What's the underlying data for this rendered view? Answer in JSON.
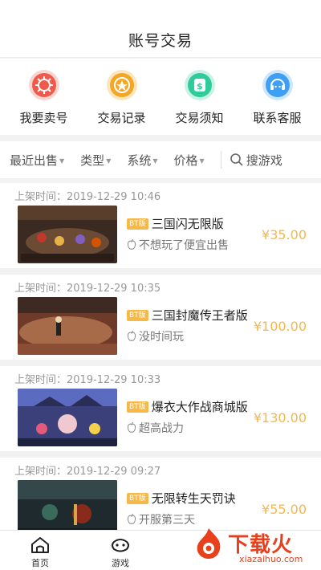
{
  "header": {
    "title": "账号交易"
  },
  "quick": [
    {
      "label": "我要卖号",
      "icon": "sell-icon",
      "color": "#f15a4a"
    },
    {
      "label": "交易记录",
      "icon": "record-icon",
      "color": "#f5a623"
    },
    {
      "label": "交易须知",
      "icon": "notice-icon",
      "color": "#2ecc9a"
    },
    {
      "label": "联系客服",
      "icon": "service-icon",
      "color": "#3ea0f5"
    }
  ],
  "filters": {
    "items": [
      "最近出售",
      "类型",
      "系统",
      "价格"
    ],
    "search": "搜游戏"
  },
  "listings": [
    {
      "time": "上架时间：2019-12-29 10:46",
      "badge": "BT版",
      "name": "三国闪无限版",
      "desc": "不想玩了便宜出售",
      "price": "¥35.00"
    },
    {
      "time": "上架时间：2019-12-29 10:35",
      "badge": "BT版",
      "name": "三国封魔传王者版",
      "desc": "没时间玩",
      "price": "¥100.00"
    },
    {
      "time": "上架时间：2019-12-29 10:33",
      "badge": "BT版",
      "name": "爆衣大作战商城版",
      "desc": "超高战力",
      "price": "¥130.00"
    },
    {
      "time": "上架时间：2019-12-29 09:27",
      "badge": "BT版",
      "name": "无限转生天罚诀",
      "desc": "开服第三天",
      "price": "¥55.00"
    }
  ],
  "tabbar": [
    {
      "label": "首页",
      "icon": "home-icon"
    },
    {
      "label": "游戏",
      "icon": "game-icon"
    }
  ],
  "watermark": {
    "brand": "下载火",
    "site": "xiazaihuo.com"
  },
  "colors": {
    "price": "#f5b84a",
    "badge": "#f5b84a",
    "watermark": "#e8401c"
  }
}
